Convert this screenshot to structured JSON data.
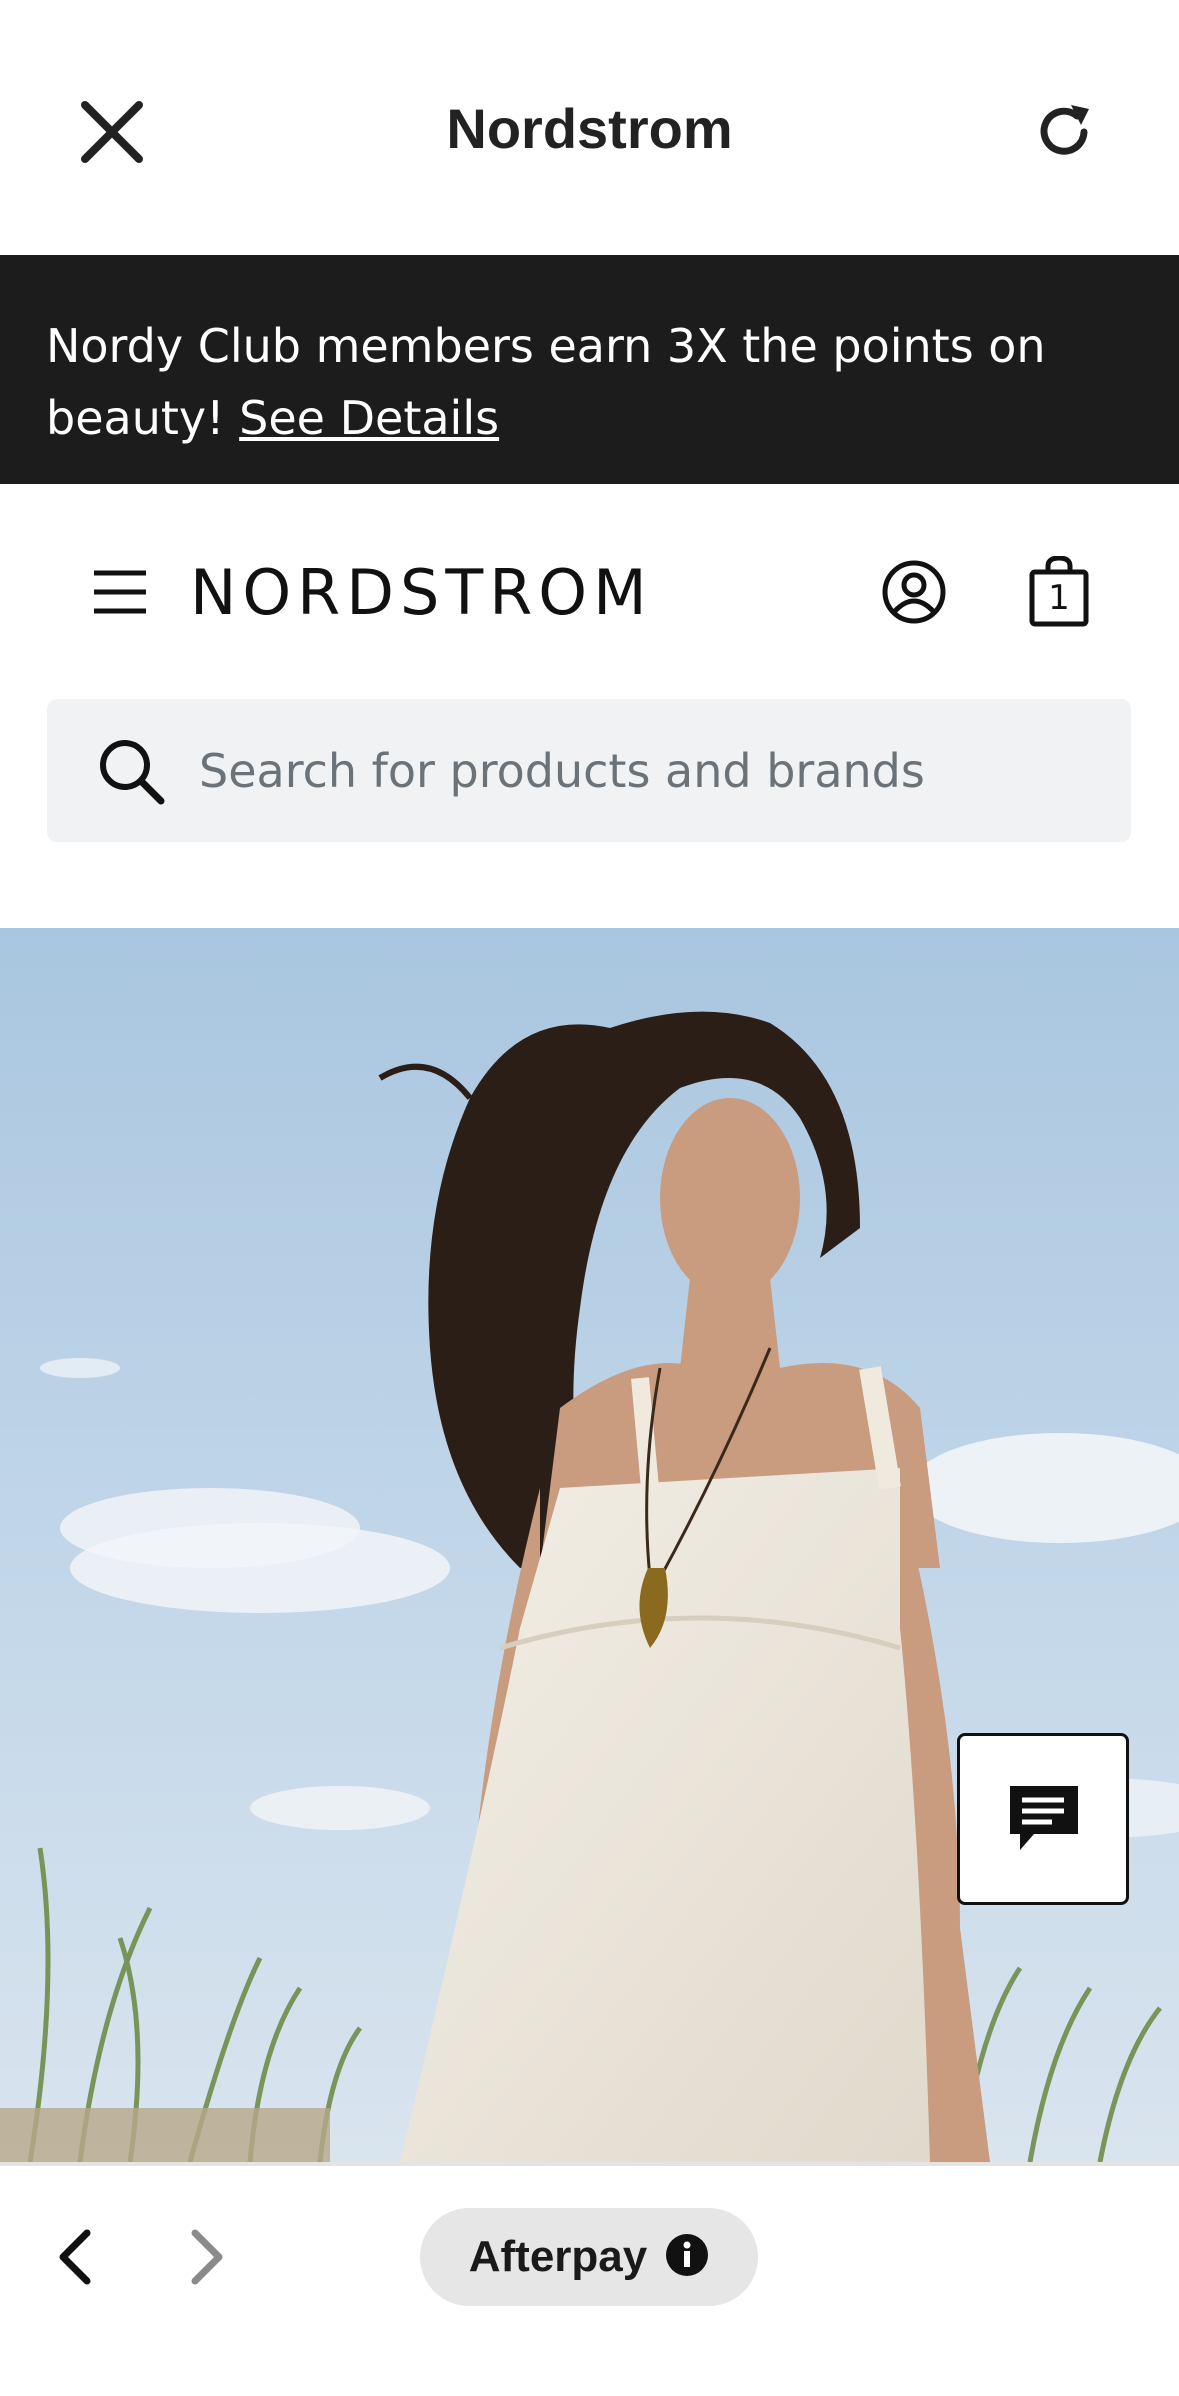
{
  "webview": {
    "title": "Nordstrom",
    "close_icon": "close-icon",
    "reload_icon": "reload-icon"
  },
  "promo": {
    "text": "Nordy Club members earn 3X the points on beauty! ",
    "link_label": "See Details"
  },
  "header": {
    "logo": "NORDSTROM",
    "menu_icon": "hamburger-menu-icon",
    "account_icon": "account-icon",
    "bag_icon": "shopping-bag-icon",
    "bag_count": "1"
  },
  "search": {
    "placeholder": "Search for products and brands",
    "value": ""
  },
  "hero": {
    "image": "woman in white sundress on dunes"
  },
  "chat": {
    "icon": "chat-icon"
  },
  "bottom_bar": {
    "back_icon": "chevron-left-icon",
    "forward_icon": "chevron-right-icon",
    "afterpay_label": "Afterpay",
    "afterpay_info_icon": "info-icon"
  },
  "colors": {
    "banner_bg": "#1c1c1c",
    "search_bg": "#f0f2f3",
    "pill_bg": "#e6e6e6"
  }
}
